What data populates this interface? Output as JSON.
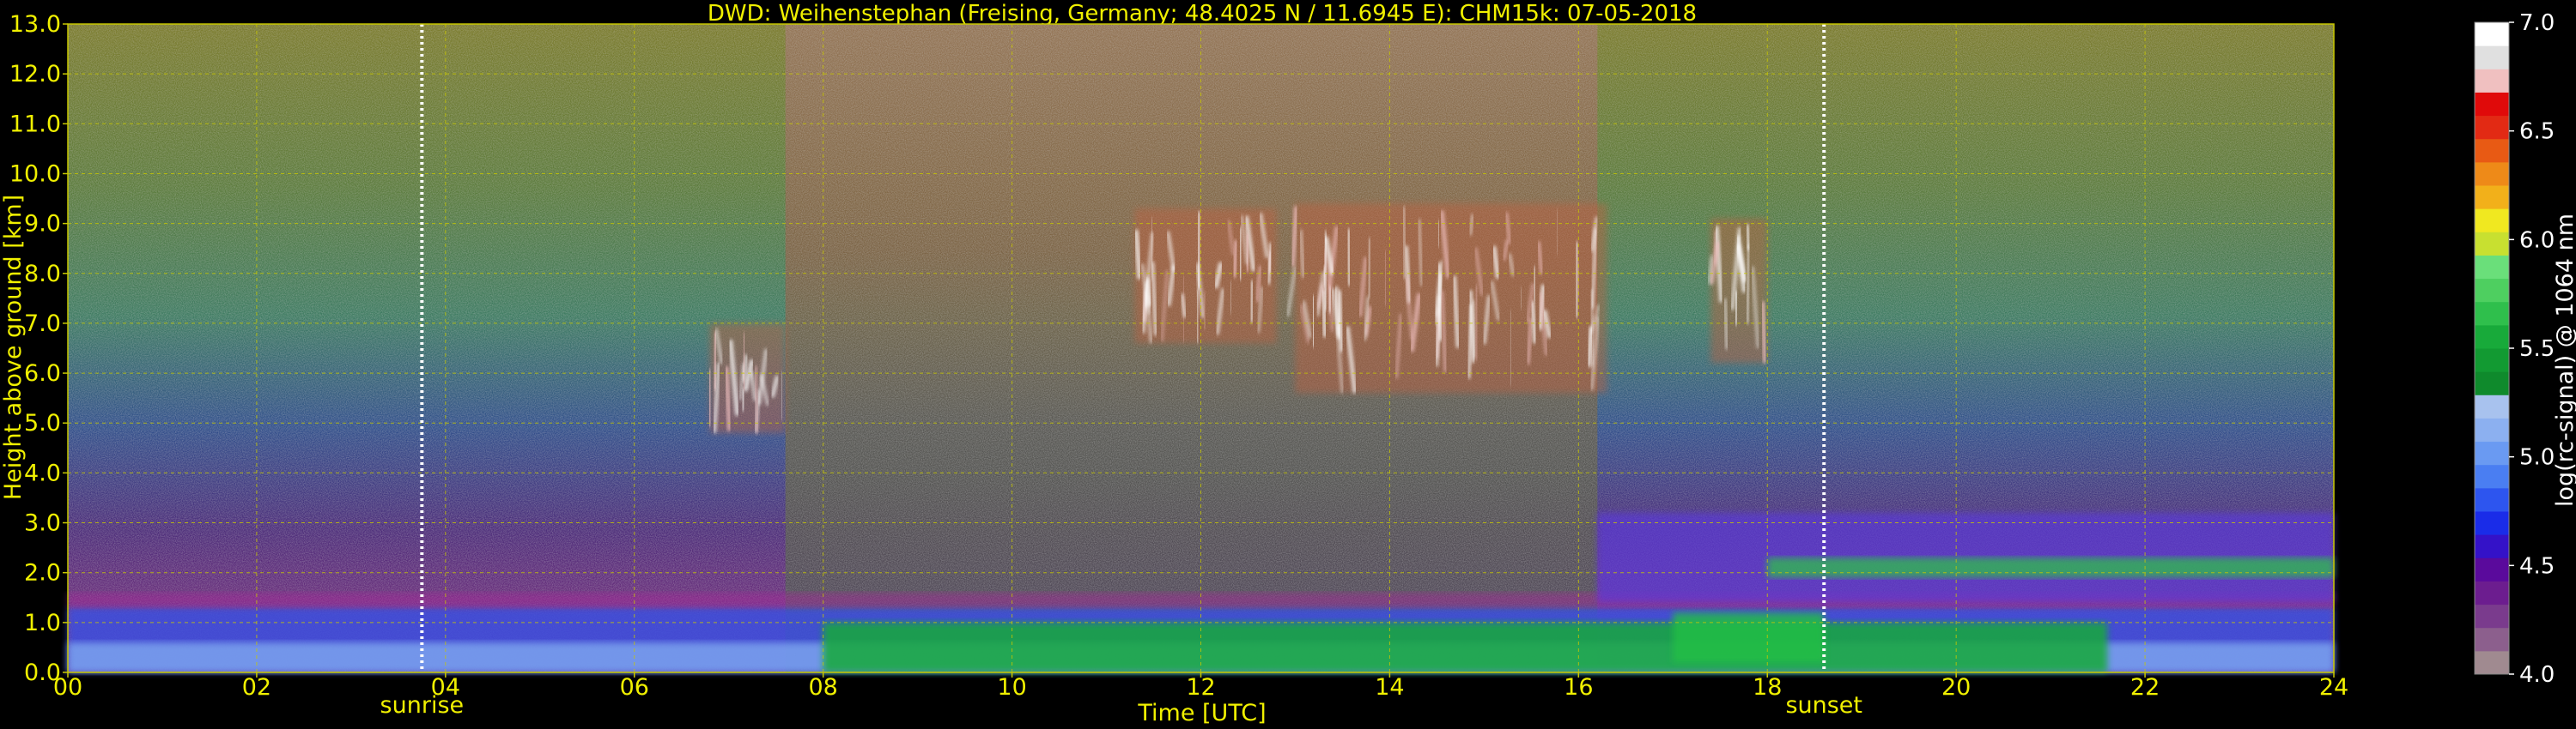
{
  "chart_data": {
    "type": "heatmap",
    "title": "DWD: Weihenstephan (Freising, Germany; 48.4025 N / 11.6945 E):    CHM15k: 07-05-2018",
    "xlabel": "Time [UTC]",
    "ylabel": "Height above ground [km]",
    "xlim": [
      0,
      24
    ],
    "ylim": [
      0,
      13
    ],
    "x_ticks": [
      "00",
      "02",
      "04",
      "06",
      "08",
      "10",
      "12",
      "14",
      "16",
      "18",
      "20",
      "22",
      "24"
    ],
    "y_ticks": [
      "0.0",
      "1.0",
      "2.0",
      "3.0",
      "4.0",
      "5.0",
      "6.0",
      "7.0",
      "8.0",
      "9.0",
      "10.0",
      "11.0",
      "12.0",
      "13.0"
    ],
    "grid": true,
    "colorbar": {
      "label": "log(rc-signal) @ 1064 nm",
      "range": [
        4.0,
        7.0
      ],
      "ticks": [
        "4.0",
        "4.5",
        "5.0",
        "5.5",
        "6.0",
        "6.5",
        "7.0"
      ],
      "colors": [
        "#a08a90",
        "#8c5f8d",
        "#7a3b8d",
        "#6c1d8f",
        "#5a0a9c",
        "#3412c8",
        "#1a2ce8",
        "#2d55ef",
        "#4a7ef2",
        "#6a9af2",
        "#8cb0f0",
        "#a8c2ee",
        "#0f8a2c",
        "#129a32",
        "#18aa3a",
        "#2fbf4c",
        "#4ecf60",
        "#6adf7a",
        "#c8e030",
        "#f0e820",
        "#f2b01a",
        "#ee8a18",
        "#e85a14",
        "#e22a14",
        "#e00a0a",
        "#f0c0c0",
        "#e0e0e0",
        "#ffffff"
      ]
    },
    "markers": [
      {
        "x": 3.75,
        "label": "sunrise"
      },
      {
        "x": 18.6,
        "label": "sunset"
      }
    ],
    "layers": [
      {
        "name": "boundary layer",
        "x_start": 0,
        "x_end": 24,
        "top_km": 1.3
      },
      {
        "name": "elevated aerosol layer",
        "x_start": 16.2,
        "x_end": 24,
        "top_km": 3.2
      }
    ],
    "clouds": [
      {
        "x_start": 6.8,
        "x_end": 7.6,
        "base_km": 4.8,
        "top_km": 7.0
      },
      {
        "x_start": 11.3,
        "x_end": 12.8,
        "base_km": 6.6,
        "top_km": 9.3
      },
      {
        "x_start": 13.0,
        "x_end": 16.3,
        "base_km": 5.6,
        "top_km": 9.4
      },
      {
        "x_start": 17.4,
        "x_end": 18.0,
        "base_km": 6.2,
        "top_km": 9.1
      }
    ]
  }
}
